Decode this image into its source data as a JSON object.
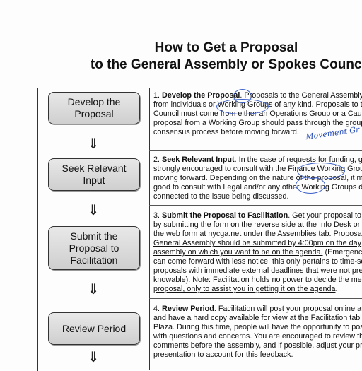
{
  "title_line1": "How to Get a Proposal",
  "title_line2": "to the General Assembly or Spokes Council",
  "flow": {
    "box1": [
      "Develop the",
      "Proposal"
    ],
    "box2": [
      "Seek Relevant",
      "Input"
    ],
    "box3": [
      "Submit the",
      "Proposal to",
      "Facilitation"
    ],
    "box4": [
      "Review Period"
    ],
    "arrow": "⇓"
  },
  "steps": {
    "s1": {
      "num": "1.",
      "title": "Develop the Proposal",
      "lines": [
        "Proposals to the General Assembly",
        "from individuals or Working Groups of any kind. Proposals to th",
        "Council must come from either an Operations Group or a Cau",
        "proposal from a Working Group should pass through the group",
        "consensus process before moving forward."
      ]
    },
    "s2": {
      "num": "2.",
      "title": "Seek Relevant Input",
      "lines": [
        ". In the case of requests for funding, g",
        "strongly encouraged to consult with the Finance Working Grou",
        "moving forward. Depending on the nature of the proposal, it m",
        "good to consult with Legal and/or any other Working Groups d",
        "connected to the issue being discussed."
      ]
    },
    "s3": {
      "num": "3.",
      "title": "Submit the Proposal to Facilitation",
      "lines": [
        ". Get your proposal to",
        "by submitting the form on the reverse side at the Info Desk or",
        "the web form at nycga.net under the Assemblies tab. ",
        "Proposal",
        "General Assembly should be submitted by 4:00pm on the day",
        "assembly on which you want to be on the agenda.",
        " (Emergency",
        "can come forward with less notice; this only pertains to time-se",
        "proposals with immediate external deadlines that were not pre",
        "knowable). Note: ",
        "Facilitation holds no power to decide the mer",
        "proposal, only to assist you in getting it on the agenda",
        "."
      ]
    },
    "s4": {
      "num": "4.",
      "title": "Review Period",
      "lines": [
        ". Facilitation will post your proposal online at",
        "and have a hard copy available for view at the Facilitation table",
        "Plaza. During this time, people will have the opportunity to pos",
        "with questions and concerns. You are encouraged to review th",
        "comments before the assembly, and if possible, adjust your pro",
        "presentation to account for this feedback."
      ]
    }
  },
  "handwriting": "Movement Gr"
}
